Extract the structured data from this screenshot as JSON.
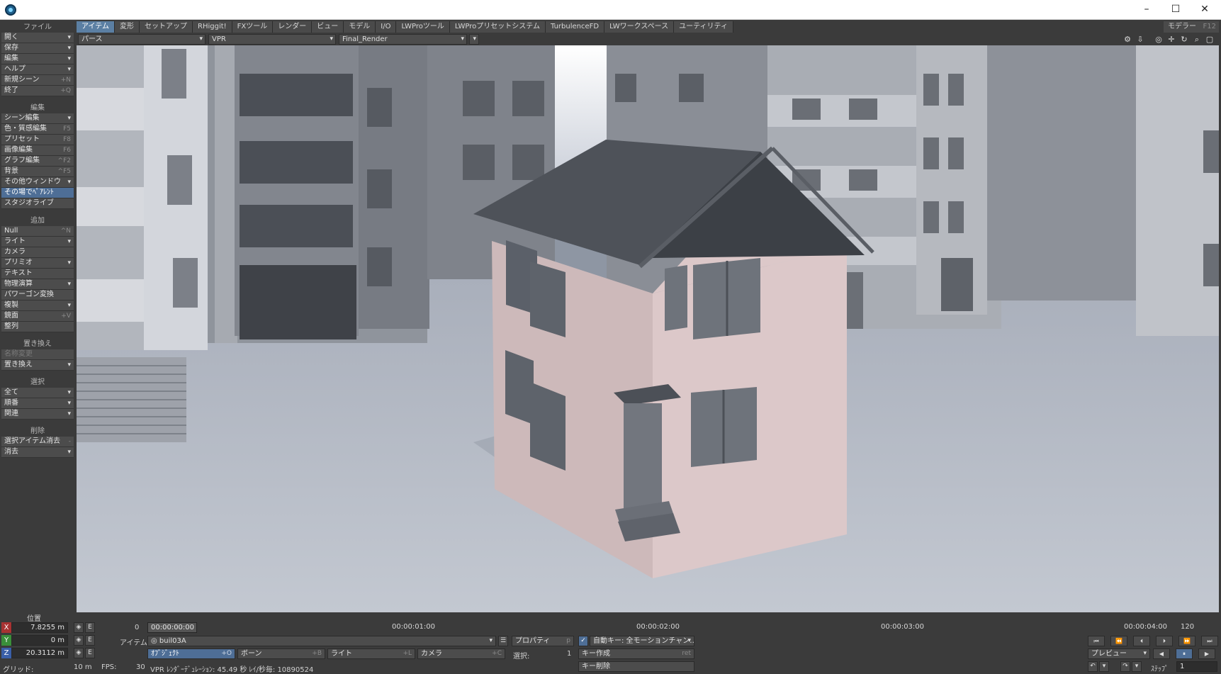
{
  "tabs": [
    "アイテム",
    "変形",
    "セットアップ",
    "RHiggit!",
    "FXツール",
    "レンダー",
    "ビュー",
    "モデル",
    "I/O",
    "LWProツール",
    "LWProプリセットシステム",
    "TurbulenceFD",
    "LWワークスペース",
    "ユーティリティ"
  ],
  "modeler": {
    "label": "モデラー",
    "shortcut": "F12"
  },
  "viewport_bar": {
    "view_mode": "パース",
    "render_mode": "VPR",
    "camera": "Final_Render"
  },
  "sidebar": {
    "file": {
      "header": "ファイル",
      "items": [
        {
          "label": "開く",
          "dropdown": true
        },
        {
          "label": "保存",
          "dropdown": true
        },
        {
          "label": "編集",
          "dropdown": true
        },
        {
          "label": "ヘルプ",
          "dropdown": true
        },
        {
          "label": "新規シーン",
          "shortcut": "+N"
        },
        {
          "label": "終了",
          "shortcut": "+Q"
        }
      ]
    },
    "edit": {
      "header": "編集",
      "items": [
        {
          "label": "シーン編集",
          "dropdown": true
        },
        {
          "label": "色・質感編集",
          "shortcut": "F5"
        },
        {
          "label": "プリセット",
          "shortcut": "F8"
        },
        {
          "label": "画像編集",
          "shortcut": "F6"
        },
        {
          "label": "グラフ編集",
          "shortcut": "^F2"
        },
        {
          "label": "背景",
          "shortcut": "^F5"
        },
        {
          "label": "その他ウィンドウ",
          "dropdown": true
        },
        {
          "label": "その場でﾍﾟｱﾚﾝﾄ"
        },
        {
          "label": "スタジオライブ"
        }
      ]
    },
    "add": {
      "header": "追加",
      "items": [
        {
          "label": "Null",
          "shortcut": "^N"
        },
        {
          "label": "ライト",
          "dropdown": true
        },
        {
          "label": "カメラ"
        },
        {
          "label": "プリミオ",
          "dropdown": true
        },
        {
          "label": "テキスト"
        },
        {
          "label": "物理演算",
          "dropdown": true
        },
        {
          "label": "パワーゴン変換"
        },
        {
          "label": "複製",
          "dropdown": true
        },
        {
          "label": "鏡面",
          "shortcut": "+V"
        },
        {
          "label": "整列"
        }
      ]
    },
    "replace": {
      "header": "置き換え",
      "items": [
        {
          "label": "名称変更"
        },
        {
          "label": "置き換え",
          "dropdown": true
        }
      ]
    },
    "select": {
      "header": "選択",
      "items": [
        {
          "label": "全て",
          "dropdown": true
        },
        {
          "label": "順番",
          "dropdown": true
        },
        {
          "label": "関連",
          "dropdown": true
        }
      ]
    },
    "delete": {
      "header": "削除",
      "items": [
        {
          "label": "選択アイテム消去",
          "shortcut": "-"
        },
        {
          "label": "消去",
          "dropdown": true
        }
      ]
    }
  },
  "position": {
    "header": "位置",
    "x": "7.8255 m",
    "y": "0 m",
    "z": "20.3112 m",
    "axis_x": "X",
    "axis_y": "Y",
    "axis_z": "Z",
    "env": "E"
  },
  "grid": {
    "label": "グリッド:",
    "value": "10 m"
  },
  "fps": {
    "label": "FPS:",
    "value": "30"
  },
  "status": "VPR ﾚﾝﾀﾞｰﾃﾞｭﾚｰｼｮﾝ: 45.49 秒  ﾚｲ/秒毎: 10890524",
  "timeline": {
    "current_frame": "0",
    "current_time": "00:00:00:00",
    "ticks": [
      "00:00:01:00",
      "00:00:02:00",
      "00:00:03:00",
      "00:00:04:00"
    ],
    "end_frame": "120"
  },
  "item_row": {
    "label": "アイテム",
    "selected": "buil03A",
    "property_label": "プロパティ",
    "property_key": "p"
  },
  "item_types": [
    {
      "label": "ｵﾌﾞｼﾞｪｸﾄ",
      "key": "+O"
    },
    {
      "label": "ボーン",
      "key": "+B"
    },
    {
      "label": "ライト",
      "key": "+L"
    },
    {
      "label": "カメラ",
      "key": "+C"
    }
  ],
  "selection": {
    "label": "選択:",
    "value": "1"
  },
  "keys": {
    "auto_key": "自動キー: 全モーションチャン…",
    "create": "キー作成",
    "create_key": "ret",
    "delete": "キー削除"
  },
  "playback": {
    "preview": "プレビュー",
    "step_label": "ｽﾃｯﾌﾟ",
    "step_value": "1"
  },
  "colors": {
    "accent": "#5b7fa3",
    "panel": "#3b3b3b",
    "button": "#4c4c4c",
    "field": "#2d2d2d",
    "house_wall": "#d8c4c4",
    "roof": "#4e5259",
    "floor": "#b7bcc7"
  }
}
